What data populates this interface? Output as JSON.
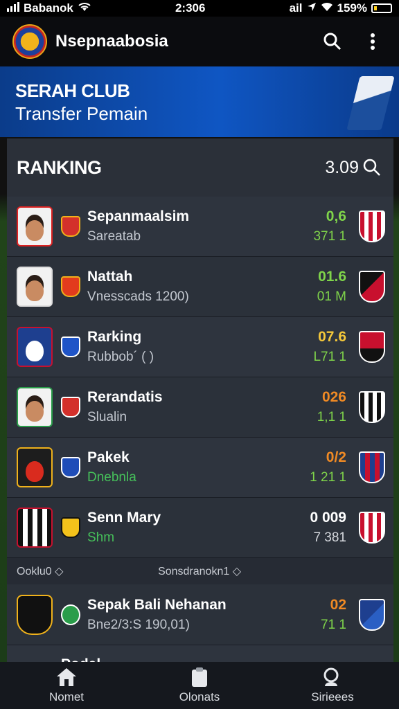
{
  "status_bar": {
    "carrier": "Babanok",
    "time": "2:306",
    "signal_label": "ail",
    "battery": "159%"
  },
  "app": {
    "title": "Nsepnaabosia"
  },
  "banner": {
    "title": "SERAH CLUB",
    "subtitle": "Transfer Pemain"
  },
  "ranking": {
    "title": "RANKING",
    "value": "3.09"
  },
  "rows": [
    {
      "name": "Sepanmaalsim",
      "sub": "Sareatab",
      "stat1": "0,6",
      "stat2": "371 1"
    },
    {
      "name": "Nattah",
      "sub": "Vnesscads 1200)",
      "stat1": "01.6",
      "stat2": "01 M"
    },
    {
      "name": "Rarking",
      "sub": "Rubbob´ (     )",
      "stat1": "07.6",
      "stat2": "L71 1"
    },
    {
      "name": "Rerandatis",
      "sub": "Slualin",
      "stat1": "026",
      "stat2": "1,1 1"
    },
    {
      "name": "Pakek",
      "sub": "Dnebnla",
      "stat1": "0/2",
      "stat2": "1   21 1"
    },
    {
      "name": "Senn Mary",
      "sub": "Shm",
      "stat1": "0   009",
      "stat2": "7   381"
    }
  ],
  "section": {
    "left": "Ooklu0 ◇",
    "right": "Sonsdranokn1 ◇"
  },
  "featured": {
    "name": "Sepak Bali Nehanan",
    "sub": "Bne2/3:S 190,01)",
    "stat1": "02",
    "stat2": "71 1"
  },
  "partial_row": {
    "name": "Podal"
  },
  "bottom_nav": [
    {
      "label": "Nomet",
      "icon": "home-icon"
    },
    {
      "label": "Olonats",
      "icon": "clipboard-icon"
    },
    {
      "label": "Sirieees",
      "icon": "search-icon"
    }
  ],
  "colors": {
    "accent_blue": "#0f56c3",
    "stat_green": "#7fd44a",
    "stat_orange": "#f08a24"
  }
}
